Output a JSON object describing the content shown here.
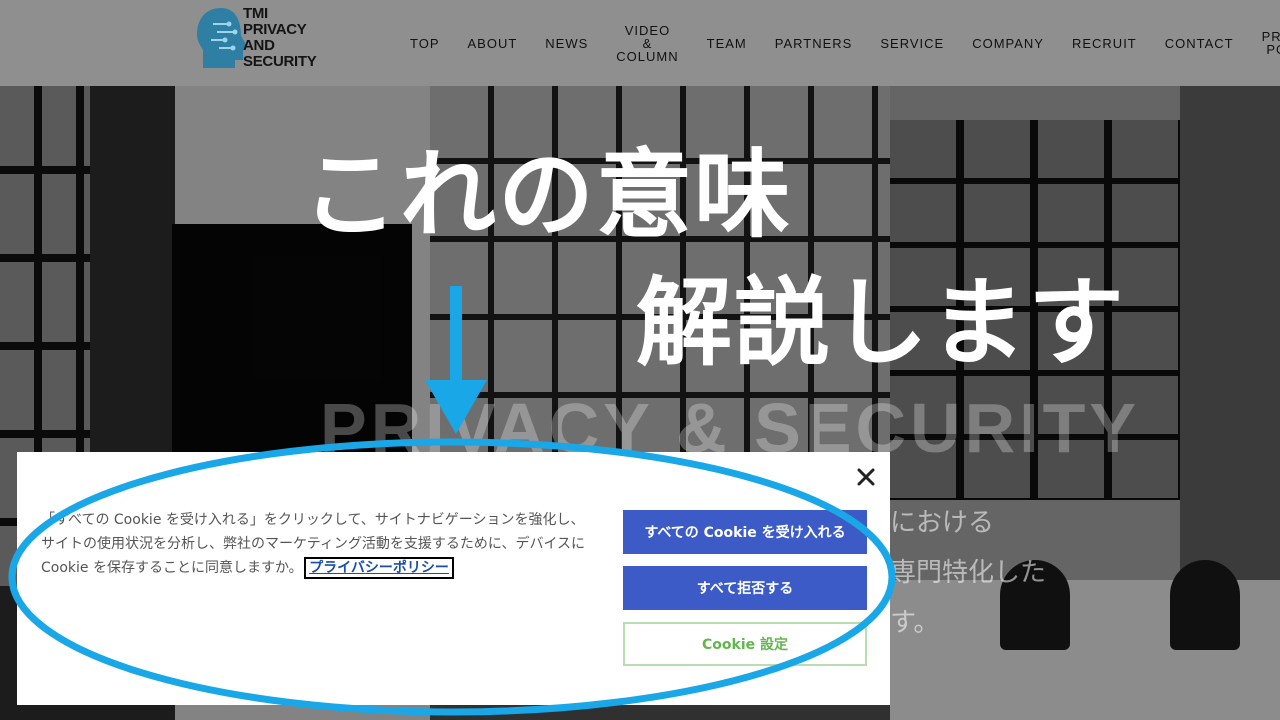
{
  "header": {
    "logo_lines": [
      "TMI",
      "PRIVACY",
      "AND",
      "SECURITY"
    ],
    "nav": [
      {
        "lines": [
          "TOP"
        ]
      },
      {
        "lines": [
          "ABOUT"
        ]
      },
      {
        "lines": [
          "NEWS"
        ]
      },
      {
        "lines": [
          "VIDEO",
          "&",
          "COLUMN"
        ]
      },
      {
        "lines": [
          "TEAM"
        ]
      },
      {
        "lines": [
          "PARTNERS"
        ]
      },
      {
        "lines": [
          "SERVICE"
        ]
      },
      {
        "lines": [
          "COMPANY"
        ]
      },
      {
        "lines": [
          "RECRUIT"
        ]
      },
      {
        "lines": [
          "CONTACT"
        ]
      },
      {
        "lines": [
          "PRIVACY",
          "POLICY"
        ]
      }
    ]
  },
  "hero": {
    "title": "PRIVACY & SECURITY",
    "sub_lines": [
      "における",
      "専門特化した",
      "す。"
    ]
  },
  "overlay": {
    "line1": "これの意味",
    "line2": "解説します",
    "accent_color": "#1aa7e8"
  },
  "cookie_banner": {
    "message": "「すべての Cookie を受け入れる」をクリックして、サイトナビゲーションを強化し、サイトの使用状況を分析し、弊社のマーケティング活動を支援するために、デバイスに Cookie を保存することに同意しますか。",
    "policy_link": "プライバシーポリシー",
    "accept_all": "すべての Cookie を受け入れる",
    "reject_all": "すべて拒否する",
    "settings": "Cookie 設定",
    "close_icon": "close-icon",
    "primary_color": "#3c5bc6",
    "settings_color": "#63b64e"
  }
}
